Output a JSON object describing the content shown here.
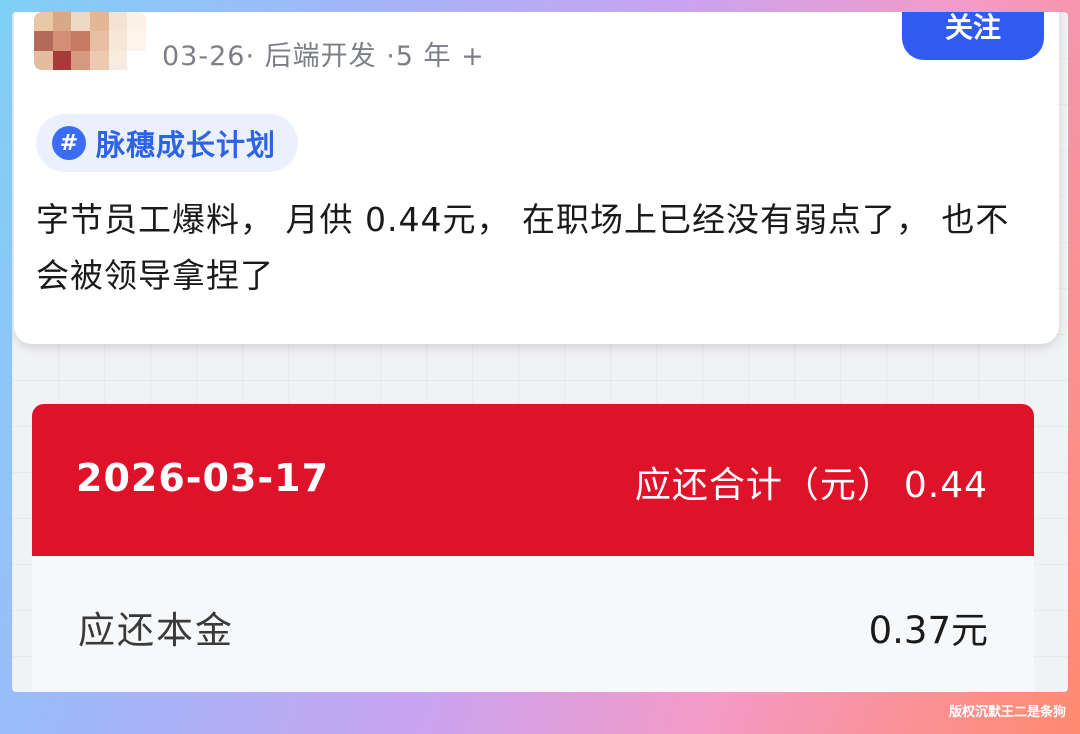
{
  "post": {
    "meta": "03-26· 后端开发 ·5 年 +",
    "follow_label": "关注",
    "topic_tag": "脉穗成长计划",
    "topic_icon": "#",
    "content": "字节员工爆料， 月供 0.44元， 在职场上已经没有弱点了， 也不会被领导拿捏了"
  },
  "bill": {
    "date": "2026-03-17",
    "total_label": "应还合计（元）",
    "total_value": "0.44",
    "rows": [
      {
        "label": "应还本金",
        "value": "0.37元"
      }
    ]
  },
  "watermark": "版权沉默王二是条狗",
  "colors": {
    "accent_blue": "#2f5bf2",
    "tag_blue": "#2e62e8",
    "bill_red": "#de1329"
  }
}
